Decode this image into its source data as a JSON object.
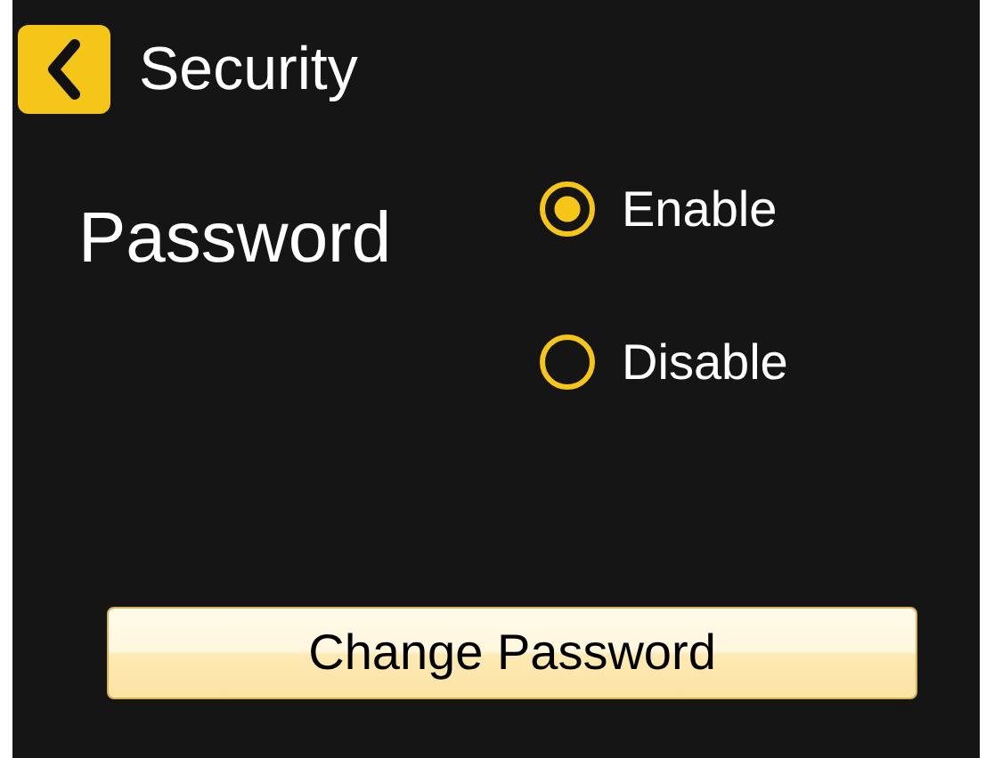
{
  "header": {
    "back": true,
    "title": "Security"
  },
  "setting": {
    "label": "Password",
    "options": [
      {
        "label": "Enable",
        "selected": true
      },
      {
        "label": "Disable",
        "selected": false
      }
    ]
  },
  "buttons": [
    "Change Password"
  ]
}
